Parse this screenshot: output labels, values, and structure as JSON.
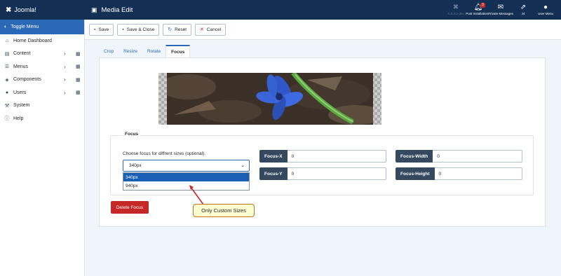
{
  "header": {
    "brand": "Joomla!",
    "page_title": "Media Edit",
    "actions": [
      {
        "icon": "joomla-icon",
        "label": "X.X.X.x  dev",
        "dim": true
      },
      {
        "icon": "bell-icon",
        "label": "Post Installation...",
        "badge": "3"
      },
      {
        "icon": "envelope-icon",
        "label": "Private Messages"
      },
      {
        "icon": "external-link-icon",
        "label": "J4"
      },
      {
        "icon": "user-icon",
        "label": "User Menu"
      }
    ]
  },
  "sidebar": {
    "toggle_label": "Toggle Menu",
    "items": [
      {
        "label": "Home Dashboard",
        "icon": "home-icon"
      },
      {
        "label": "Content",
        "icon": "file-icon",
        "has_sub": true
      },
      {
        "label": "Menus",
        "icon": "list-icon",
        "has_sub": true
      },
      {
        "label": "Components",
        "icon": "cubes-icon",
        "has_sub": true
      },
      {
        "label": "Users",
        "icon": "users-icon",
        "has_sub": true
      },
      {
        "label": "System",
        "icon": "wrench-icon"
      },
      {
        "label": "Help",
        "icon": "info-icon"
      }
    ]
  },
  "toolbar": {
    "save": "Save",
    "save_close": "Save & Close",
    "reset": "Reset",
    "cancel": "Cancel"
  },
  "tabs": [
    "Crop",
    "Resize",
    "Rotate",
    "Focus"
  ],
  "active_tab": "Focus",
  "focus": {
    "legend": "Focus",
    "hint": "Choose focus for diffrent sizes (optional).",
    "selected": "340px",
    "options": [
      "340px",
      "940px"
    ],
    "focus_x_label": "Focus-X",
    "focus_x_value": "0",
    "focus_y_label": "Focus-Y",
    "focus_y_value": "0",
    "focus_width_label": "Focus-Width",
    "focus_width_value": "0",
    "focus_height_label": "Focus-Height",
    "focus_height_value": "0",
    "delete_label": "Delete Focus"
  },
  "annotation": {
    "text": "Only Custom Sizes"
  },
  "colors": {
    "header_bg": "#132f53",
    "accent": "#2a69b8",
    "danger": "#c52827",
    "callout_bg": "#ffffd0"
  }
}
